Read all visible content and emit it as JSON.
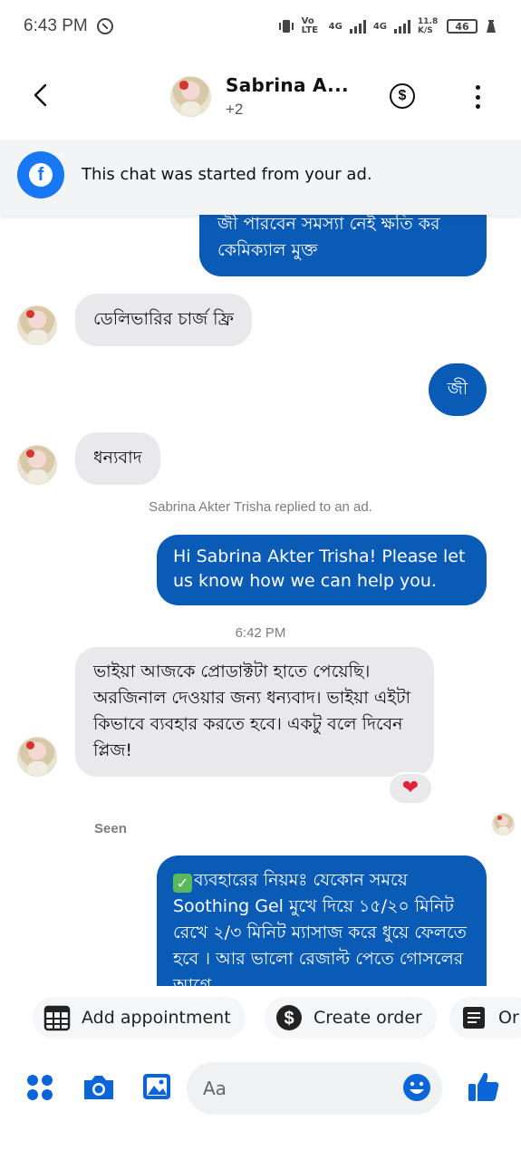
{
  "status_bar": {
    "time": "6:43 PM",
    "network1": "Vo LTE",
    "network2": "4G",
    "network3": "4G",
    "speed": "11.8 K/S",
    "battery": "46"
  },
  "header": {
    "name": "Sabrina A...",
    "participants": "+2"
  },
  "ad_banner": {
    "text": "This chat was started from your ad."
  },
  "messages": [
    {
      "side": "out",
      "text": "জী পারবেন সমস্যা নেই ক্ষতি কর কেমিক্যাল মুক্ত"
    },
    {
      "side": "in",
      "text": "ডেলিভারির চার্জ ফ্রি"
    },
    {
      "side": "out",
      "text": "জী"
    },
    {
      "side": "in",
      "text": "ধন্যবাদ"
    },
    {
      "side": "system",
      "text": "Sabrina Akter Trisha replied to an ad."
    },
    {
      "side": "out",
      "text": "Hi Sabrina Akter Trisha! Please let us know how we can help you."
    },
    {
      "side": "timestamp",
      "text": "6:42 PM"
    },
    {
      "side": "in",
      "text": "ভাইয়া আজকে প্রোডাক্টটা হাতে পেয়েছি। অরজিনাল দেওয়ার জন্য ধন্যবাদ। ভাইয়া এইটা কিভাবে ব্যবহার করতে হবে। একটু বলে দিবেন প্লিজ!",
      "reaction": "❤"
    },
    {
      "side": "seen",
      "text": "Seen"
    },
    {
      "side": "out",
      "text": "ব্যবহারের নিয়মঃ যেকোন সময়ে Soothing Gel মুখে দিয়ে ১৫/২০ মিনিট রেখে ২/৩ মিনিট ম্যাসাজ করে ধুয়ে ফেলতে হবে । আর ভালো রেজাল্ট পেতে গোসলের আগে"
    }
  ],
  "quick_actions": [
    {
      "label": "Add appointment",
      "icon": "calendar-icon"
    },
    {
      "label": "Create order",
      "icon": "dollar-icon"
    },
    {
      "label": "Or",
      "icon": "order-list-icon"
    }
  ],
  "composer": {
    "placeholder": "Aa"
  },
  "colors": {
    "outgoing_bubble": "#0a5bb5",
    "incoming_bubble": "#e9e9ec",
    "accent": "#1877f2"
  }
}
